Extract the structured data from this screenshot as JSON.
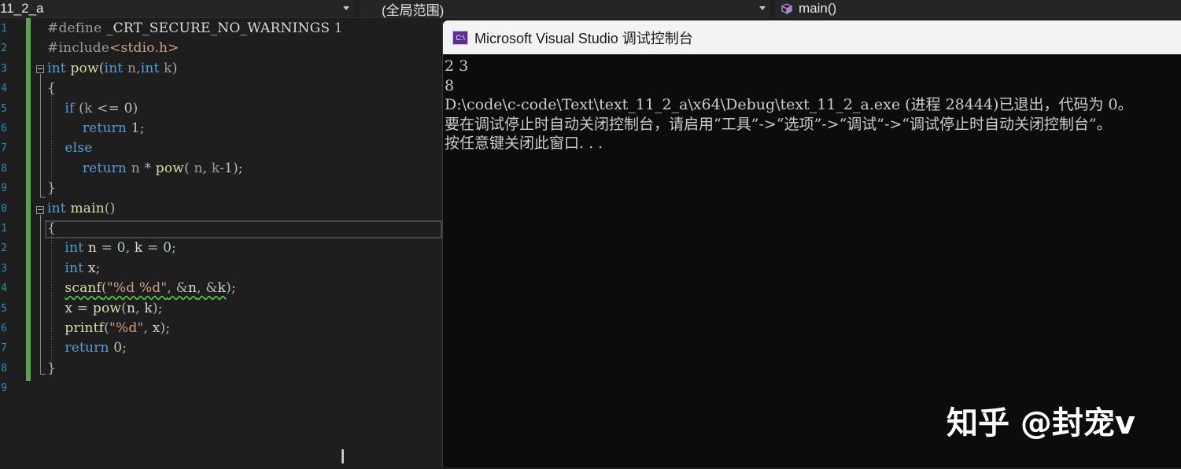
{
  "toolbar": {
    "project": "11_2_a",
    "scope": "(全局范围)",
    "function": "main()",
    "function_icon": "cube-icon"
  },
  "editor": {
    "line_numbers": [
      "1",
      "2",
      "3",
      "4",
      "5",
      "6",
      "7",
      "8",
      "9",
      "0",
      "1",
      "2",
      "3",
      "4",
      "5",
      "6",
      "7",
      "8",
      "9"
    ],
    "lines": [
      [
        {
          "c": "pp",
          "t": "#define "
        },
        {
          "c": "id",
          "t": "_CRT_SECURE_NO_WARNINGS"
        },
        {
          "c": "num",
          "t": " 1"
        }
      ],
      [
        {
          "c": "pp",
          "t": "#include"
        },
        {
          "c": "str",
          "t": "<stdio.h>"
        }
      ],
      [
        {
          "c": "kw",
          "t": "int"
        },
        {
          "c": "id",
          "t": " "
        },
        {
          "c": "fn",
          "t": "pow"
        },
        {
          "c": "op",
          "t": "("
        },
        {
          "c": "kw",
          "t": "int"
        },
        {
          "c": "param",
          "t": " n,"
        },
        {
          "c": "kw",
          "t": "int"
        },
        {
          "c": "param",
          "t": " k"
        },
        {
          "c": "op",
          "t": ")"
        }
      ],
      [
        {
          "c": "op",
          "t": "{"
        }
      ],
      [
        {
          "c": "id",
          "t": "    "
        },
        {
          "c": "kw",
          "t": "if"
        },
        {
          "c": "op",
          "t": " ("
        },
        {
          "c": "param",
          "t": "k"
        },
        {
          "c": "op",
          "t": " <= "
        },
        {
          "c": "num",
          "t": "0"
        },
        {
          "c": "op",
          "t": ")"
        }
      ],
      [
        {
          "c": "id",
          "t": "        "
        },
        {
          "c": "kw",
          "t": "return"
        },
        {
          "c": "num",
          "t": " 1"
        },
        {
          "c": "op",
          "t": ";"
        }
      ],
      [
        {
          "c": "id",
          "t": "    "
        },
        {
          "c": "kw",
          "t": "else"
        }
      ],
      [
        {
          "c": "id",
          "t": "        "
        },
        {
          "c": "kw",
          "t": "return"
        },
        {
          "c": "param",
          "t": " n"
        },
        {
          "c": "op",
          "t": " * "
        },
        {
          "c": "fn",
          "t": "pow"
        },
        {
          "c": "op",
          "t": "( "
        },
        {
          "c": "param",
          "t": "n"
        },
        {
          "c": "op",
          "t": ", "
        },
        {
          "c": "param",
          "t": "k"
        },
        {
          "c": "op",
          "t": "-"
        },
        {
          "c": "num",
          "t": "1"
        },
        {
          "c": "op",
          "t": ");"
        }
      ],
      [
        {
          "c": "op",
          "t": "}"
        }
      ],
      [
        {
          "c": "kw",
          "t": "int"
        },
        {
          "c": "id",
          "t": " "
        },
        {
          "c": "fn",
          "t": "main"
        },
        {
          "c": "op",
          "t": "()"
        }
      ],
      [
        {
          "c": "op",
          "t": "{"
        }
      ],
      [
        {
          "c": "id",
          "t": "    "
        },
        {
          "c": "kw",
          "t": "int"
        },
        {
          "c": "id",
          "t": " n"
        },
        {
          "c": "op",
          "t": " = "
        },
        {
          "c": "num",
          "t": "0"
        },
        {
          "c": "op",
          "t": ", "
        },
        {
          "c": "id",
          "t": "k"
        },
        {
          "c": "op",
          "t": " = "
        },
        {
          "c": "num",
          "t": "0"
        },
        {
          "c": "op",
          "t": ";"
        }
      ],
      [
        {
          "c": "id",
          "t": "    "
        },
        {
          "c": "kw",
          "t": "int"
        },
        {
          "c": "id",
          "t": " x"
        },
        {
          "c": "op",
          "t": ";"
        }
      ],
      [
        {
          "c": "id",
          "t": "    "
        },
        {
          "c": "fn squig",
          "t": "scanf"
        },
        {
          "c": "op squig",
          "t": "("
        },
        {
          "c": "str squig",
          "t": "\"%d %d\""
        },
        {
          "c": "op squig",
          "t": ", &"
        },
        {
          "c": "id squig",
          "t": "n"
        },
        {
          "c": "op squig",
          "t": ", &"
        },
        {
          "c": "id squig",
          "t": "k"
        },
        {
          "c": "op",
          "t": ");"
        }
      ],
      [
        {
          "c": "id",
          "t": "    x"
        },
        {
          "c": "op",
          "t": " = "
        },
        {
          "c": "fn",
          "t": "pow"
        },
        {
          "c": "op",
          "t": "("
        },
        {
          "c": "id",
          "t": "n"
        },
        {
          "c": "op",
          "t": ", "
        },
        {
          "c": "id",
          "t": "k"
        },
        {
          "c": "op",
          "t": ");"
        }
      ],
      [
        {
          "c": "id",
          "t": "    "
        },
        {
          "c": "fn",
          "t": "printf"
        },
        {
          "c": "op",
          "t": "("
        },
        {
          "c": "str",
          "t": "\"%d\""
        },
        {
          "c": "op",
          "t": ", "
        },
        {
          "c": "id",
          "t": "x"
        },
        {
          "c": "op",
          "t": ");"
        }
      ],
      [
        {
          "c": "id",
          "t": "    "
        },
        {
          "c": "kw",
          "t": "return"
        },
        {
          "c": "num",
          "t": " 0"
        },
        {
          "c": "op",
          "t": ";"
        }
      ],
      [
        {
          "c": "op",
          "t": "}"
        }
      ]
    ]
  },
  "console": {
    "title": "Microsoft Visual Studio 调试控制台",
    "icon_label": "C:\\",
    "output": [
      "2 3",
      "8",
      "D:\\code\\c-code\\Text\\text_11_2_a\\x64\\Debug\\text_11_2_a.exe (进程 28444)已退出，代码为 0。",
      "要在调试停止时自动关闭控制台，请启用“工具”->“选项”->“调试”->“调试停止时自动关闭控制台”。",
      "按任意键关闭此窗口. . ."
    ]
  },
  "watermark": "知乎 @封宠v"
}
